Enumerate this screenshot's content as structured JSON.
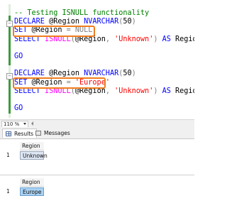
{
  "editor": {
    "lines": [
      {
        "parts": [
          {
            "t": "-- Testing ISNULL functionality",
            "c": "cm"
          }
        ]
      },
      {
        "parts": [
          {
            "t": "DECLARE",
            "c": "kw"
          },
          {
            "t": " @Region ",
            "c": "tx"
          },
          {
            "t": "NVARCHAR",
            "c": "kw"
          },
          {
            "t": "(",
            "c": "gy"
          },
          {
            "t": "50",
            "c": "tx"
          },
          {
            "t": ")",
            "c": "gy"
          }
        ]
      },
      {
        "parts": [
          {
            "t": "SET",
            "c": "kw"
          },
          {
            "t": " @Region ",
            "c": "tx"
          },
          {
            "t": "=",
            "c": "gy"
          },
          {
            "t": " ",
            "c": "tx"
          },
          {
            "t": "NULL",
            "c": "gy"
          }
        ]
      },
      {
        "parts": [
          {
            "t": "SELECT",
            "c": "kw"
          },
          {
            "t": " ",
            "c": "tx"
          },
          {
            "t": "ISNULL",
            "c": "fn"
          },
          {
            "t": "(",
            "c": "gy"
          },
          {
            "t": "@Region",
            "c": "tx"
          },
          {
            "t": ",",
            "c": "gy"
          },
          {
            "t": " ",
            "c": "tx"
          },
          {
            "t": "'Unknown'",
            "c": "st"
          },
          {
            "t": ")",
            "c": "gy"
          },
          {
            "t": " ",
            "c": "tx"
          },
          {
            "t": "AS",
            "c": "kw"
          },
          {
            "t": " Region",
            "c": "tx"
          },
          {
            "t": ";",
            "c": "gy"
          }
        ]
      },
      {
        "parts": []
      },
      {
        "parts": [
          {
            "t": "GO",
            "c": "kw"
          }
        ]
      },
      {
        "parts": []
      },
      {
        "parts": [
          {
            "t": "DECLARE",
            "c": "kw"
          },
          {
            "t": " @Region ",
            "c": "tx"
          },
          {
            "t": "NVARCHAR",
            "c": "kw"
          },
          {
            "t": "(",
            "c": "gy"
          },
          {
            "t": "50",
            "c": "tx"
          },
          {
            "t": ")",
            "c": "gy"
          }
        ]
      },
      {
        "parts": [
          {
            "t": "SET",
            "c": "kw"
          },
          {
            "t": " @Region ",
            "c": "tx"
          },
          {
            "t": "=",
            "c": "gy"
          },
          {
            "t": " ",
            "c": "tx"
          },
          {
            "t": "'Europe'",
            "c": "st"
          }
        ]
      },
      {
        "parts": [
          {
            "t": "SELECT",
            "c": "kw"
          },
          {
            "t": " ",
            "c": "tx"
          },
          {
            "t": "ISNULL",
            "c": "fn"
          },
          {
            "t": "(",
            "c": "gy"
          },
          {
            "t": "@Region",
            "c": "tx"
          },
          {
            "t": ",",
            "c": "gy"
          },
          {
            "t": " ",
            "c": "tx"
          },
          {
            "t": "'Unknown'",
            "c": "st"
          },
          {
            "t": ")",
            "c": "gy"
          },
          {
            "t": " ",
            "c": "tx"
          },
          {
            "t": "AS",
            "c": "kw"
          },
          {
            "t": " Region",
            "c": "tx"
          },
          {
            "t": ";",
            "c": "gy"
          }
        ]
      },
      {
        "parts": []
      },
      {
        "parts": [
          {
            "t": "GO",
            "c": "kw"
          }
        ]
      }
    ]
  },
  "statusbar": {
    "zoom": "110 %"
  },
  "tabs": {
    "results_label": "Results",
    "messages_label": "Messages"
  },
  "results": {
    "grid1": {
      "header": "Region",
      "rownum": "1",
      "value": "Unknown"
    },
    "grid2": {
      "header": "Region",
      "rownum": "1",
      "value": "Europe"
    }
  },
  "colors": {
    "highlight_box": "#f07d1e",
    "keyword": "#0000ff",
    "comment": "#008000",
    "string": "#ff0000",
    "function": "#ff00ff",
    "selected_cell": "#a9d1f2"
  }
}
